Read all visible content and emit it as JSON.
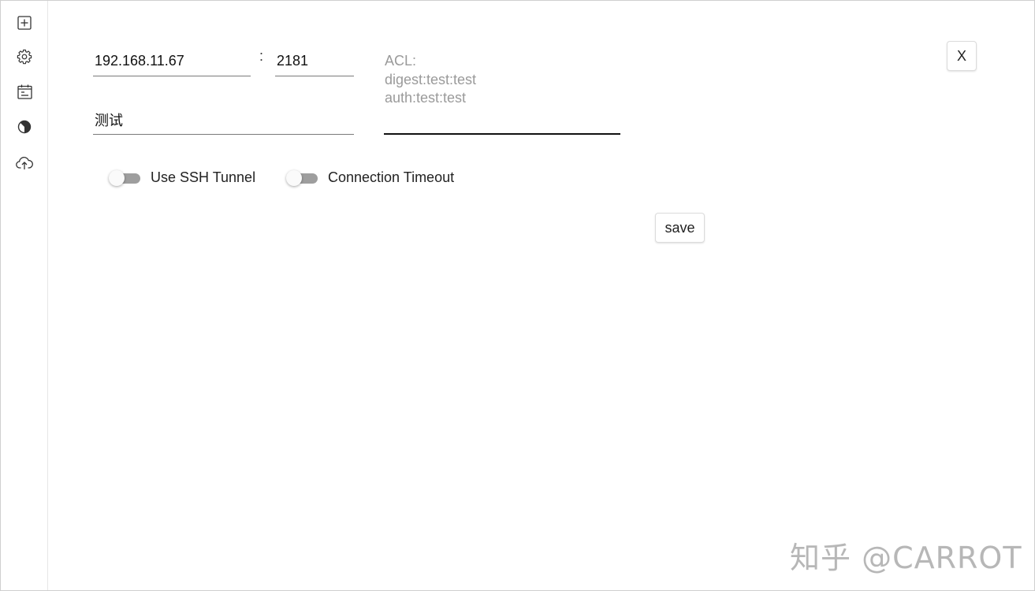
{
  "sidebar": {
    "items": [
      {
        "icon": "add-square-icon"
      },
      {
        "icon": "gear-icon"
      },
      {
        "icon": "calendar-icon"
      },
      {
        "icon": "contrast-icon"
      },
      {
        "icon": "cloud-upload-icon"
      }
    ]
  },
  "form": {
    "host": "192.168.11.67",
    "separator": ":",
    "port": "2181",
    "name": "测试",
    "acl_placeholder": "ACL:\ndigest:test:test\nauth:test:test"
  },
  "toggles": {
    "ssh_tunnel": {
      "label": "Use SSH Tunnel",
      "on": false
    },
    "connection_timeout": {
      "label": "Connection Timeout",
      "on": false
    }
  },
  "buttons": {
    "close_label": "X",
    "save_label": "save"
  },
  "watermark": {
    "text": "知乎 @CARROT"
  },
  "colors": {
    "toggle_track_off": "#9e9e9e",
    "text_primary": "#222222",
    "placeholder": "#9a9a9a"
  }
}
